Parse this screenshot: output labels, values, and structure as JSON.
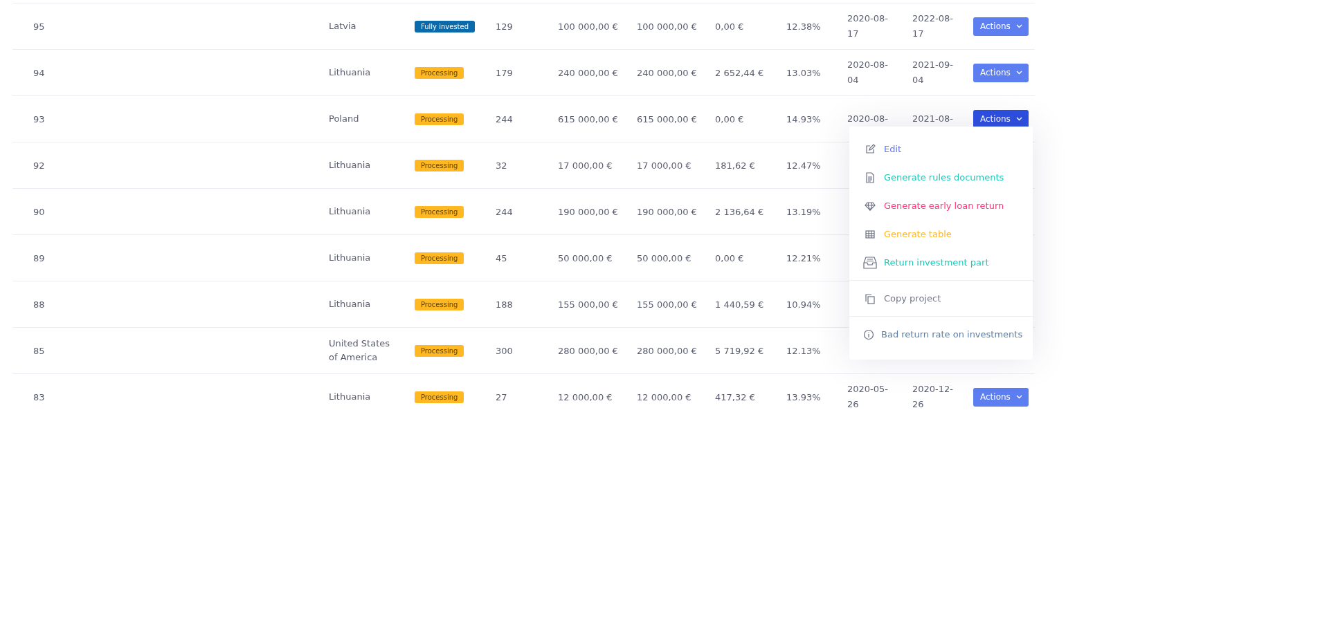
{
  "rows": [
    {
      "column_1": "95",
      "column_2": "Latvia",
      "column_3": {
        "label": "Fully invested",
        "kind": "fully_invested"
      },
      "column_4": "129",
      "column_5": "100 000,00 €",
      "column_6": "100 000,00 €",
      "column_7": "0,00 €",
      "column_8": "12.38%",
      "column_9": "2020-08-17",
      "column_10": "2022-08-17",
      "column_11": {
        "label": "Actions",
        "selected": false
      }
    },
    {
      "column_1": "94",
      "column_2": "Lithuania",
      "column_3": {
        "label": "Processing",
        "kind": "processing"
      },
      "column_4": "179",
      "column_5": "240 000,00 €",
      "column_6": "240 000,00 €",
      "column_7": "2 652,44 €",
      "column_8": "13.03%",
      "column_9": "2020-08-04",
      "column_10": "2021-09-04",
      "column_11": {
        "label": "Actions",
        "selected": false
      }
    },
    {
      "column_1": "93",
      "column_2": "Poland",
      "column_3": {
        "label": "Processing",
        "kind": "processing"
      },
      "column_4": "244",
      "column_5": "615 000,00 €",
      "column_6": "615 000,00 €",
      "column_7": "0,00 €",
      "column_8": "14.93%",
      "column_9": "2020-08-",
      "column_10": "2021-08-",
      "column_11": {
        "label": "Actions",
        "selected": true
      }
    },
    {
      "column_1": "92",
      "column_2": "Lithuania",
      "column_3": {
        "label": "Processing",
        "kind": "processing"
      },
      "column_4": "32",
      "column_5": "17 000,00 €",
      "column_6": "17 000,00 €",
      "column_7": "181,62 €",
      "column_8": "12.47%"
    },
    {
      "column_1": "90",
      "column_2": "Lithuania",
      "column_3": {
        "label": "Processing",
        "kind": "processing"
      },
      "column_4": "244",
      "column_5": "190 000,00 €",
      "column_6": "190 000,00 €",
      "column_7": "2 136,64 €",
      "column_8": "13.19%"
    },
    {
      "column_1": "89",
      "column_2": "Lithuania",
      "column_3": {
        "label": "Processing",
        "kind": "processing"
      },
      "column_4": "45",
      "column_5": "50 000,00 €",
      "column_6": "50 000,00 €",
      "column_7": "0,00 €",
      "column_8": "12.21%"
    },
    {
      "column_1": "88",
      "column_2": "Lithuania",
      "column_3": {
        "label": "Processing",
        "kind": "processing"
      },
      "column_4": "188",
      "column_5": "155 000,00 €",
      "column_6": "155 000,00 €",
      "column_7": "1 440,59 €",
      "column_8": "10.94%"
    },
    {
      "column_1": "85",
      "column_2": "United States of America",
      "column_3": {
        "label": "Processing",
        "kind": "processing"
      },
      "column_4": "300",
      "column_5": "280 000,00 €",
      "column_6": "280 000,00 €",
      "column_7": "5 719,92 €",
      "column_8": "12.13%"
    },
    {
      "column_1": "83",
      "column_2": "Lithuania",
      "column_3": {
        "label": "Processing",
        "kind": "processing"
      },
      "column_4": "27",
      "column_5": "12 000,00 €",
      "column_6": "12 000,00 €",
      "column_7": "417,32 €",
      "column_8": "13.93%",
      "column_9": "2020-05-26",
      "column_10": "2020-12-26",
      "column_11": {
        "label": "Actions",
        "selected": false
      }
    }
  ],
  "actions_menu": {
    "sections": [
      {
        "items": [
          {
            "label": "Edit",
            "kind": "edit",
            "color": "#5d78ff"
          },
          {
            "label": "Generate rules documents",
            "kind": "document",
            "color": "#1dc9b7"
          },
          {
            "label": "Generate early loan return",
            "kind": "gem",
            "color": "#fd397a"
          },
          {
            "label": "Generate table",
            "kind": "grid",
            "color": "#ffb822"
          },
          {
            "label": "Return investment part",
            "kind": "tray",
            "color": "#1dc9b7"
          }
        ]
      },
      {
        "items": [
          {
            "label": "Copy project",
            "kind": "copy",
            "color": "#74788d"
          }
        ]
      },
      {
        "items": [
          {
            "label": "Bad return rate on investments",
            "kind": "info",
            "color": "#5b7fa6"
          }
        ]
      }
    ]
  }
}
